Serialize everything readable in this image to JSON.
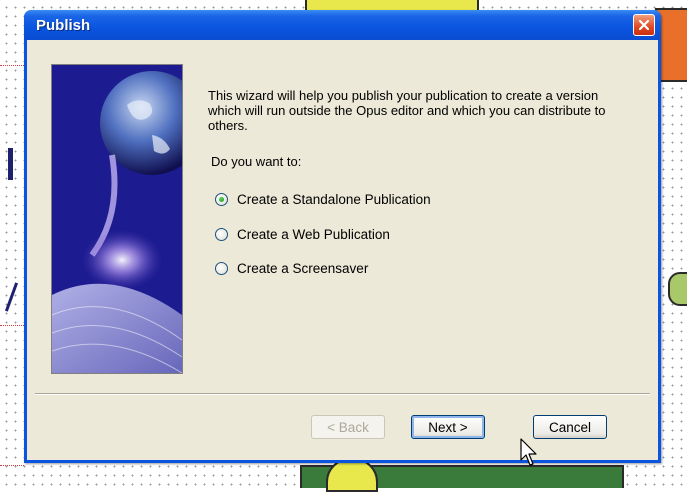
{
  "dialog": {
    "title": "Publish",
    "description": "This wizard will help you publish your publication to create a version which will run outside the Opus editor and which you can distribute to others.",
    "question": "Do you want to:",
    "options": [
      {
        "label": "Create a Standalone Publication",
        "checked": true
      },
      {
        "label": "Create a Web Publication",
        "checked": false
      },
      {
        "label": "Create a Screensaver",
        "checked": false
      }
    ],
    "buttons": {
      "back": "< Back",
      "next": "Next >",
      "cancel": "Cancel"
    }
  },
  "colors": {
    "titlebar": "#0a55e0",
    "client": "#ece9d8",
    "close": "#e04820"
  },
  "icons": {
    "close": "close-icon",
    "side_image": "earth-book-illustration",
    "pointer": "mouse-pointer-icon"
  }
}
